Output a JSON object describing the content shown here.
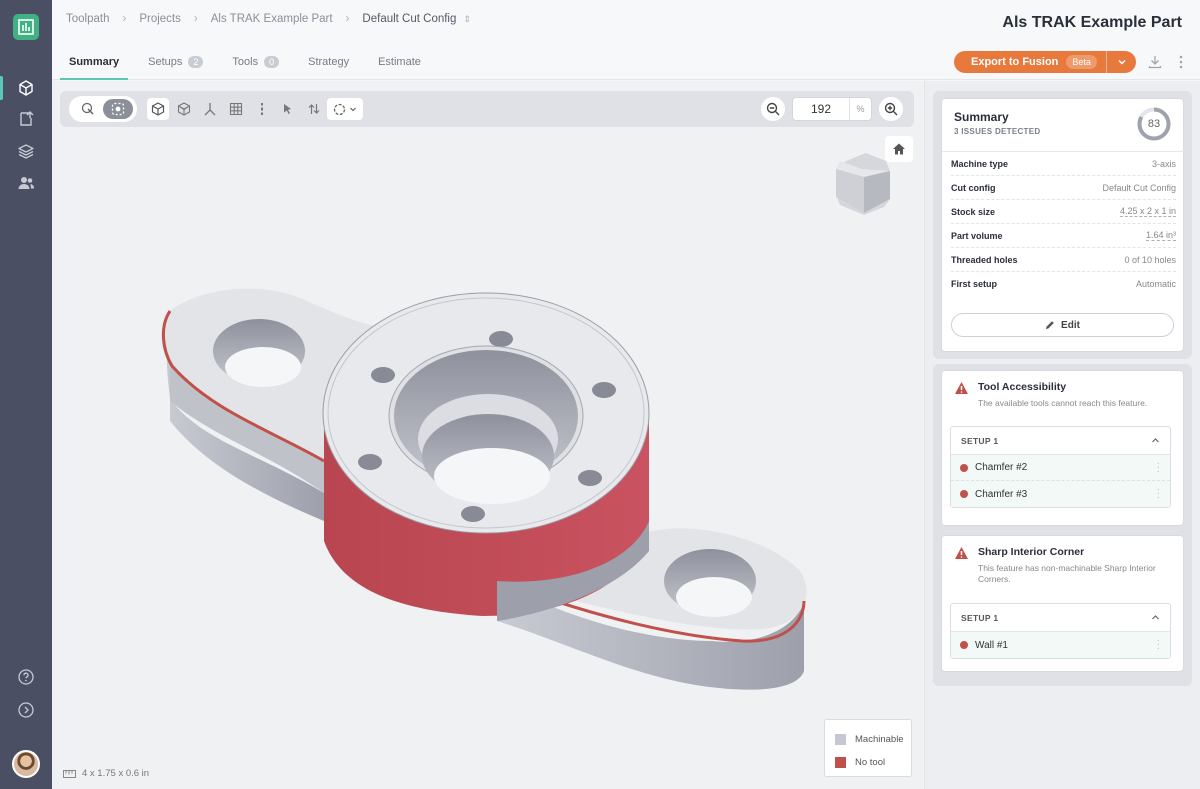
{
  "breadcrumb": {
    "items": [
      "Toolpath",
      "Projects",
      "Als TRAK Example Part",
      "Default Cut Config"
    ]
  },
  "header": {
    "part_title": "Als TRAK Example Part"
  },
  "tabs": [
    {
      "label": "Summary",
      "active": true,
      "badge": ""
    },
    {
      "label": "Setups",
      "active": false,
      "badge": "2"
    },
    {
      "label": "Tools",
      "active": false,
      "badge": "0"
    },
    {
      "label": "Strategy",
      "active": false,
      "badge": ""
    },
    {
      "label": "Estimate",
      "active": false,
      "badge": ""
    }
  ],
  "export": {
    "label": "Export to Fusion",
    "badge": "Beta"
  },
  "viewport": {
    "zoom_value": "192",
    "zoom_unit": "%",
    "dimensions": "4 x 1.75 x 0.6 in",
    "legend": [
      {
        "label": "Machinable",
        "color": "#c5c8d0"
      },
      {
        "label": "No tool",
        "color": "#c0504a"
      }
    ]
  },
  "summary": {
    "title": "Summary",
    "issues_label": "3 ISSUES DETECTED",
    "score": "83",
    "score_fraction": 0.83,
    "rows": [
      {
        "key": "Machine type",
        "value": "3-axis"
      },
      {
        "key": "Cut config",
        "value": "Default Cut Config"
      },
      {
        "key": "Stock size",
        "value": "4.25 x 2 x 1 in"
      },
      {
        "key": "Part volume",
        "value": "1.64 in³"
      },
      {
        "key": "Threaded holes",
        "value": "0 of 10 holes"
      },
      {
        "key": "First setup",
        "value": "Automatic"
      }
    ],
    "edit_label": "Edit"
  },
  "issues": [
    {
      "title": "Tool Accessibility",
      "description": "The available tools cannot reach this feature.",
      "setup_label": "SETUP 1",
      "features": [
        "Chamfer #2",
        "Chamfer #3"
      ]
    },
    {
      "title": "Sharp Interior Corner",
      "description": "This feature has non-machinable Sharp Interior Corners.",
      "setup_label": "SETUP 1",
      "features": [
        "Wall #1"
      ]
    }
  ],
  "colors": {
    "accent": "#5cc7b7",
    "export": "#e8793d",
    "error": "#c0504a",
    "rail": "#4a4f63"
  }
}
